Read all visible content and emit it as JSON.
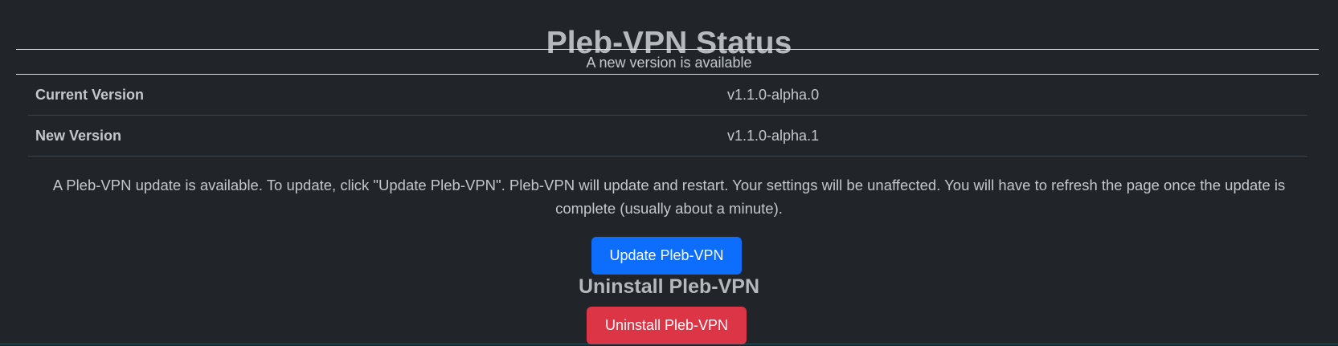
{
  "page": {
    "title": "Pleb-VPN Status",
    "notice": "A new version is available"
  },
  "versions": {
    "rows": [
      {
        "label": "Current Version",
        "value": "v1.1.0-alpha.0"
      },
      {
        "label": "New Version",
        "value": "v1.1.0-alpha.1"
      }
    ]
  },
  "update": {
    "info": "A Pleb-VPN update is available. To update, click \"Update Pleb-VPN\". Pleb-VPN will update and restart. Your settings will be unaffected. You will have to refresh the page once the update is complete (usually about a minute).",
    "button_label": "Update Pleb-VPN"
  },
  "uninstall": {
    "heading": "Uninstall Pleb-VPN",
    "button_label": "Uninstall Pleb-VPN"
  },
  "colors": {
    "background": "#212529",
    "primary_button": "#0d6efd",
    "danger_button": "#dc3545"
  }
}
